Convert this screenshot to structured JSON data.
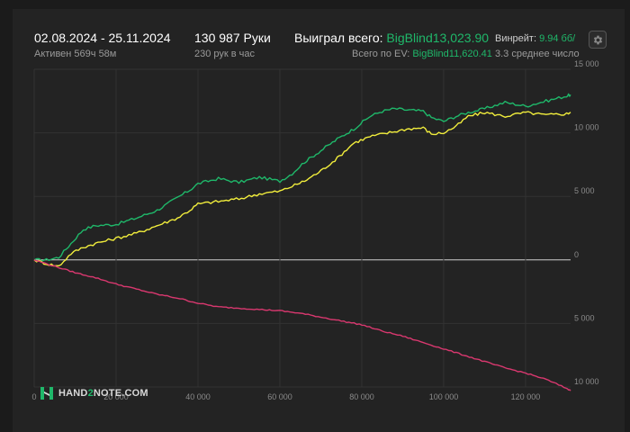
{
  "header": {
    "date_range": "02.08.2024 - 25.11.2024",
    "active_time": "Активен 569ч 58м",
    "hands_count": "130 987 Руки",
    "hands_per_hour": "230 рук в час",
    "won_label": "Выиграл всего:",
    "won_value": "BigBlind13,023.90",
    "ev_label": "Всего по EV:",
    "ev_value": "BigBlind11,620.41",
    "winrate_label": "Винрейт:",
    "winrate_value": "9.94 бб/",
    "avg_text": "3.3 среднее число"
  },
  "logo": {
    "text_a": "HAND",
    "text_two": "2",
    "text_b": "NOTE.COM"
  },
  "colors": {
    "background": "#232323",
    "won": "#1fb86a",
    "ev": "#f2ee3c",
    "nonshowdown": "#d9386f",
    "zero_line": "#cfcfcf",
    "grid": "#333333",
    "axis_text": "#8a8a8a"
  },
  "chart_data": {
    "type": "line",
    "xlim": [
      0,
      131000
    ],
    "ylim": [
      -10000,
      15000
    ],
    "x_ticks": [
      0,
      20000,
      40000,
      60000,
      80000,
      100000,
      120000
    ],
    "x_tick_labels": [
      "0",
      "20 000",
      "40 000",
      "60 000",
      "80 000",
      "100 000",
      "120 000"
    ],
    "y_ticks": [
      15000,
      10000,
      5000,
      0,
      -5000,
      -10000
    ],
    "y_tick_labels": [
      "15 000",
      "10 000",
      "5 000",
      "0",
      "5 000",
      "10 000"
    ],
    "grid": true,
    "series": [
      {
        "color": "#1fb86a",
        "x": [
          0,
          3000,
          6000,
          9000,
          12000,
          15000,
          20000,
          25000,
          30000,
          35000,
          38000,
          40000,
          45000,
          50000,
          55000,
          60000,
          63000,
          66000,
          70000,
          74000,
          78000,
          82000,
          85000,
          88000,
          91000,
          95000,
          97000,
          100000,
          103000,
          106000,
          110000,
          115000,
          120000,
          125000,
          130000,
          131000
        ],
        "y": [
          0,
          0,
          200,
          1300,
          2400,
          2700,
          2800,
          3300,
          3900,
          4900,
          5500,
          6000,
          6400,
          6100,
          6500,
          6200,
          6800,
          7700,
          8600,
          9500,
          10300,
          11300,
          11700,
          11900,
          11800,
          11700,
          11200,
          10900,
          11300,
          11600,
          11900,
          12400,
          12100,
          12500,
          12900,
          13000
        ]
      },
      {
        "color": "#f2ee3c",
        "x": [
          0,
          3000,
          6000,
          9000,
          12000,
          15000,
          20000,
          25000,
          30000,
          35000,
          38000,
          40000,
          45000,
          50000,
          55000,
          60000,
          63000,
          66000,
          70000,
          74000,
          78000,
          82000,
          85000,
          88000,
          91000,
          95000,
          97000,
          100000,
          103000,
          106000,
          110000,
          115000,
          120000,
          125000,
          130000,
          131000
        ],
        "y": [
          0,
          -300,
          -500,
          500,
          1000,
          1300,
          1700,
          2100,
          2700,
          3300,
          3900,
          4400,
          4600,
          4800,
          5200,
          5400,
          5800,
          6200,
          7000,
          8000,
          9200,
          9700,
          9900,
          10100,
          10300,
          10400,
          9900,
          10000,
          10500,
          11300,
          11600,
          11300,
          11600,
          11400,
          11500,
          11620
        ]
      },
      {
        "color": "#d9386f",
        "x": [
          0,
          5000,
          10000,
          15000,
          20000,
          25000,
          30000,
          35000,
          40000,
          45000,
          50000,
          55000,
          60000,
          65000,
          70000,
          75000,
          80000,
          85000,
          90000,
          95000,
          100000,
          105000,
          110000,
          115000,
          120000,
          125000,
          130000,
          131000
        ],
        "y": [
          0,
          -500,
          -1000,
          -1400,
          -1900,
          -2300,
          -2700,
          -3000,
          -3400,
          -3700,
          -3800,
          -3900,
          -4000,
          -4200,
          -4500,
          -4800,
          -5100,
          -5600,
          -6000,
          -6500,
          -7000,
          -7500,
          -8000,
          -8500,
          -8900,
          -9400,
          -10100,
          -10300
        ]
      }
    ]
  }
}
